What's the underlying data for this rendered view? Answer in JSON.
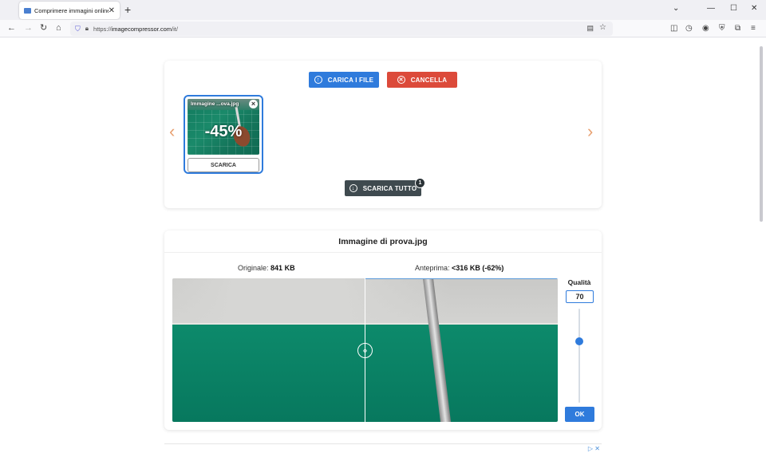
{
  "browser": {
    "tab_title": "Comprimere immagini online",
    "tab_close": "✕",
    "new_tab": "+",
    "url_prefix": "https://",
    "url_host": "imagecompressor.com",
    "url_path": "/it/",
    "window_controls": {
      "minimize": "—",
      "maximize": "☐",
      "close": "✕",
      "dropdown": "⌄"
    }
  },
  "upload": {
    "upload_label": "CARICA I FILE",
    "cancel_label": "CANCELLA",
    "download_all_label": "SCARICA TUTTO",
    "download_all_count": "1",
    "prev_arrow": "‹",
    "next_arrow": "›",
    "file": {
      "name": "Immagine ...ova.jpg",
      "reduction": "-45%",
      "download_label": "SCARICA"
    }
  },
  "preview": {
    "title": "Immagine di prova.jpg",
    "original_label": "Originale:",
    "original_size": "841 KB",
    "preview_label": "Anteprima:",
    "preview_size": "<316 KB (-62%)",
    "quality_label": "Qualità",
    "quality_value": "70",
    "quality_slider_fraction": 0.7,
    "ok_label": "OK"
  },
  "colors": {
    "accent": "#2f7bdc",
    "danger": "#dc4a3a",
    "dark_button": "#3f4a4f",
    "arrow": "#e8a070"
  }
}
